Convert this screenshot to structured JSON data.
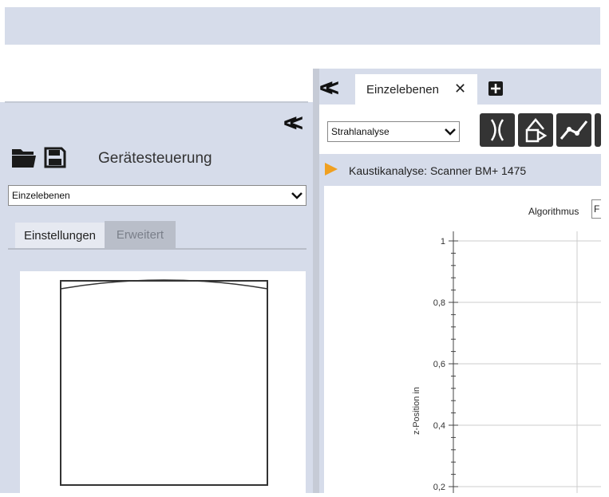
{
  "left_panel": {
    "title": "Gerätesteuerung",
    "mode_select": "Einzelebenen",
    "tabs": [
      {
        "label": "Einstellungen",
        "active": true
      },
      {
        "label": "Erweitert",
        "active": false
      }
    ],
    "icons": [
      "open-folder-icon",
      "save-icon"
    ]
  },
  "document": {
    "tab_label": "Einzelebenen",
    "tab_close": "✕",
    "analysis_select": "Strahlanalyse",
    "tool_icons": [
      "caustic-icon",
      "beam-shape-icon",
      "line-graph-icon"
    ],
    "analysis_title": "Kaustikanalyse: Scanner BM+ 1475",
    "algorithm_label": "Algorithmus",
    "algorithm_value": "F"
  },
  "chart_data": {
    "type": "line",
    "ylabel": "z-Position in",
    "ylim": [
      0,
      1
    ],
    "yticks": [
      "1",
      "0,8",
      "0,6",
      "0,4",
      "0,2"
    ],
    "series": []
  },
  "colors": {
    "panel_bg": "#d6dcea",
    "accent_flag": "#f0a020",
    "tool_btn": "#343434"
  }
}
